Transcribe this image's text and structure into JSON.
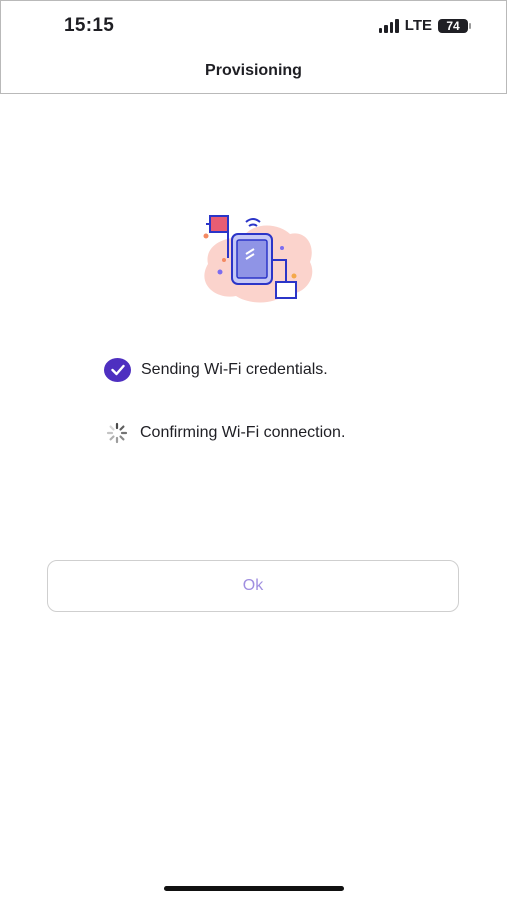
{
  "status_bar": {
    "time": "15:15",
    "network": "LTE",
    "battery": "74"
  },
  "header": {
    "title": "Provisioning"
  },
  "illustration": {
    "icon": "device-provisioning-illustration"
  },
  "steps": [
    {
      "label": "Sending Wi-Fi credentials.",
      "state": "complete",
      "icon": "check-circle-icon"
    },
    {
      "label": "Confirming Wi-Fi connection.",
      "state": "in-progress",
      "icon": "spinner-icon"
    }
  ],
  "actions": {
    "ok_label": "Ok"
  },
  "colors": {
    "accent": "#4e2fc0",
    "button_text_disabled": "#a08fe0",
    "illustration_blob": "#fbd3cc",
    "illustration_line": "#2b35c8"
  }
}
